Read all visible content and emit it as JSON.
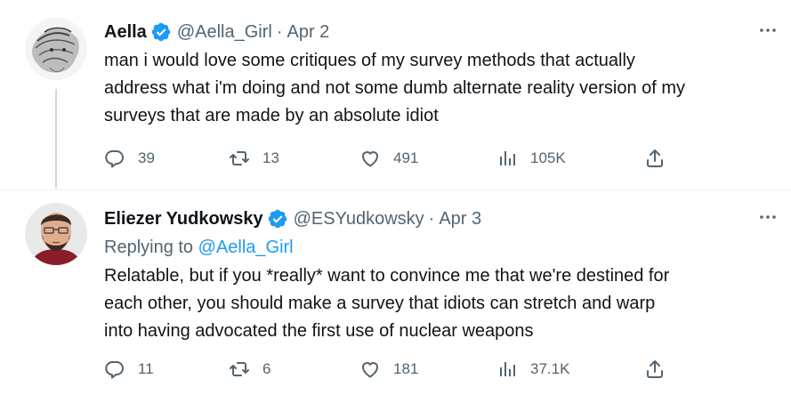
{
  "colors": {
    "accent": "#1d9bf0",
    "secondary_text": "#536471",
    "primary_text": "#0f1419",
    "thread_line": "#cfd9de"
  },
  "tweets": [
    {
      "author_name": "Aella",
      "handle": "@Aella_Girl",
      "separator": "·",
      "date": "Apr 2",
      "replying_prefix": "",
      "replying_to": "",
      "text": "man i would love some critiques of my survey methods that actually\naddress what i'm doing and not some dumb alternate reality version of my\nsurveys that are made by an absolute idiot",
      "replies": "39",
      "retweets": "13",
      "likes": "491",
      "views": "105K",
      "icons": [
        "verified-badge-icon",
        "more-icon",
        "reply-icon",
        "retweet-icon",
        "like-icon",
        "views-icon",
        "share-icon"
      ]
    },
    {
      "author_name": "Eliezer Yudkowsky",
      "handle": "@ESYudkowsky",
      "separator": "·",
      "date": "Apr 3",
      "replying_prefix": "Replying to ",
      "replying_to": "@Aella_Girl",
      "text": "Relatable, but if you *really* want to convince me that we're destined for\neach other, you should make a survey that idiots can stretch and warp\ninto having advocated the first use of nuclear weapons",
      "replies": "11",
      "retweets": "6",
      "likes": "181",
      "views": "37.1K",
      "icons": [
        "verified-badge-icon",
        "more-icon",
        "reply-icon",
        "retweet-icon",
        "like-icon",
        "views-icon",
        "share-icon"
      ]
    }
  ]
}
